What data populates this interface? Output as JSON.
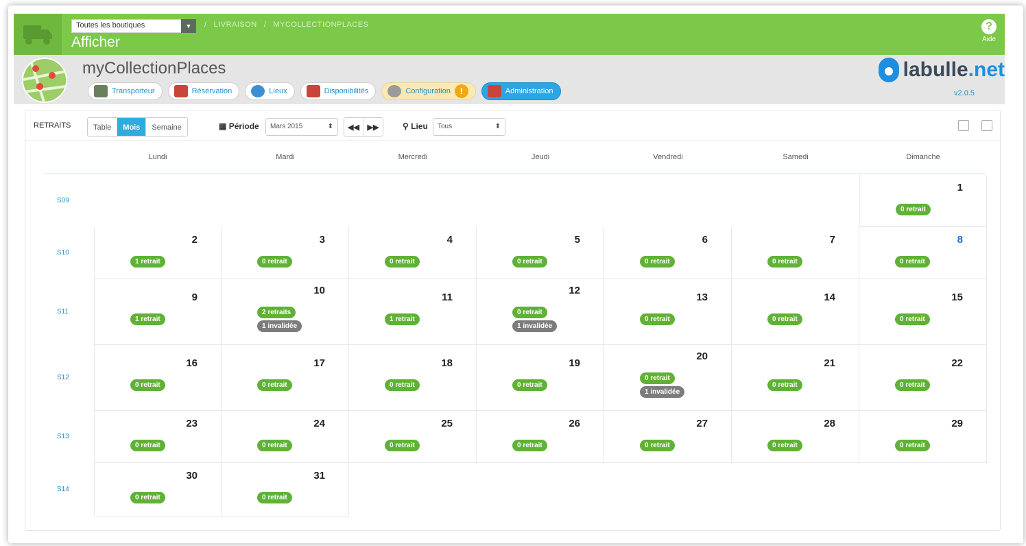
{
  "header": {
    "shop_select": "Toutes les boutiques",
    "breadcrumb": [
      "LIVRAISON",
      "MYCOLLECTIONPLACES"
    ],
    "page_action": "Afficher",
    "help_label": "Aide"
  },
  "module": {
    "title": "myCollectionPlaces",
    "brand_main": "labulle",
    "brand_suffix": ".net",
    "version": "v2.0.5",
    "nav": [
      {
        "label": "Transporteur",
        "icon": "truck-icon"
      },
      {
        "label": "Réservation",
        "icon": "calendar-check-icon"
      },
      {
        "label": "Lieux",
        "icon": "globe-icon"
      },
      {
        "label": "Disponibilités",
        "icon": "calendar-cross-icon"
      },
      {
        "label": "Configuration",
        "icon": "gear-icon"
      },
      {
        "label": "Administration",
        "icon": "calendar-icon"
      }
    ]
  },
  "toolbar": {
    "section_label": "RETRAITS",
    "views": [
      "Table",
      "Mois",
      "Semaine"
    ],
    "active_view": "Mois",
    "periode_label": "Période",
    "periode_value": "Mars 2015",
    "prev": "◀◀",
    "next": "▶▶",
    "lieu_label": "Lieu",
    "lieu_value": "Tous"
  },
  "calendar": {
    "days": [
      "Lundi",
      "Mardi",
      "Mercredi",
      "Jeudi",
      "Vendredi",
      "Samedi",
      "Dimanche"
    ],
    "weeks": [
      {
        "label": "S09",
        "cells": [
          null,
          null,
          null,
          null,
          null,
          null,
          {
            "day": "1",
            "badges": [
              "0 retrait"
            ]
          }
        ]
      },
      {
        "label": "S10",
        "cells": [
          {
            "day": "2",
            "badges": [
              "1 retrait"
            ]
          },
          {
            "day": "3",
            "badges": [
              "0 retrait"
            ]
          },
          {
            "day": "4",
            "badges": [
              "0 retrait"
            ]
          },
          {
            "day": "5",
            "badges": [
              "0 retrait"
            ]
          },
          {
            "day": "6",
            "badges": [
              "0 retrait"
            ]
          },
          {
            "day": "7",
            "badges": [
              "0 retrait"
            ]
          },
          {
            "day": "8",
            "badges": [
              "0 retrait"
            ],
            "today": true
          }
        ]
      },
      {
        "label": "S11",
        "cells": [
          {
            "day": "9",
            "badges": [
              "1 retrait"
            ]
          },
          {
            "day": "10",
            "badges": [
              "2 retraits"
            ],
            "grey": [
              "1 invalidée"
            ]
          },
          {
            "day": "11",
            "badges": [
              "1 retrait"
            ]
          },
          {
            "day": "12",
            "badges": [
              "0 retrait"
            ],
            "grey": [
              "1 invalidée"
            ]
          },
          {
            "day": "13",
            "badges": [
              "0 retrait"
            ]
          },
          {
            "day": "14",
            "badges": [
              "0 retrait"
            ]
          },
          {
            "day": "15",
            "badges": [
              "0 retrait"
            ]
          }
        ]
      },
      {
        "label": "S12",
        "cells": [
          {
            "day": "16",
            "badges": [
              "0 retrait"
            ]
          },
          {
            "day": "17",
            "badges": [
              "0 retrait"
            ]
          },
          {
            "day": "18",
            "badges": [
              "0 retrait"
            ]
          },
          {
            "day": "19",
            "badges": [
              "0 retrait"
            ]
          },
          {
            "day": "20",
            "badges": [
              "0 retrait"
            ],
            "grey": [
              "1 invalidée"
            ]
          },
          {
            "day": "21",
            "badges": [
              "0 retrait"
            ]
          },
          {
            "day": "22",
            "badges": [
              "0 retrait"
            ]
          }
        ]
      },
      {
        "label": "S13",
        "cells": [
          {
            "day": "23",
            "badges": [
              "0 retrait"
            ]
          },
          {
            "day": "24",
            "badges": [
              "0 retrait"
            ]
          },
          {
            "day": "25",
            "badges": [
              "0 retrait"
            ]
          },
          {
            "day": "26",
            "badges": [
              "0 retrait"
            ]
          },
          {
            "day": "27",
            "badges": [
              "0 retrait"
            ]
          },
          {
            "day": "28",
            "badges": [
              "0 retrait"
            ]
          },
          {
            "day": "29",
            "badges": [
              "0 retrait"
            ]
          }
        ]
      },
      {
        "label": "S14",
        "cells": [
          {
            "day": "30",
            "badges": [
              "0 retrait"
            ]
          },
          {
            "day": "31",
            "badges": [
              "0 retrait"
            ]
          },
          null,
          null,
          null,
          null,
          null
        ]
      }
    ]
  },
  "colors": {
    "header_green": "#7cc94a",
    "badge_green": "#5fb236",
    "badge_grey": "#7c7c7c",
    "accent_blue": "#2eacde"
  }
}
